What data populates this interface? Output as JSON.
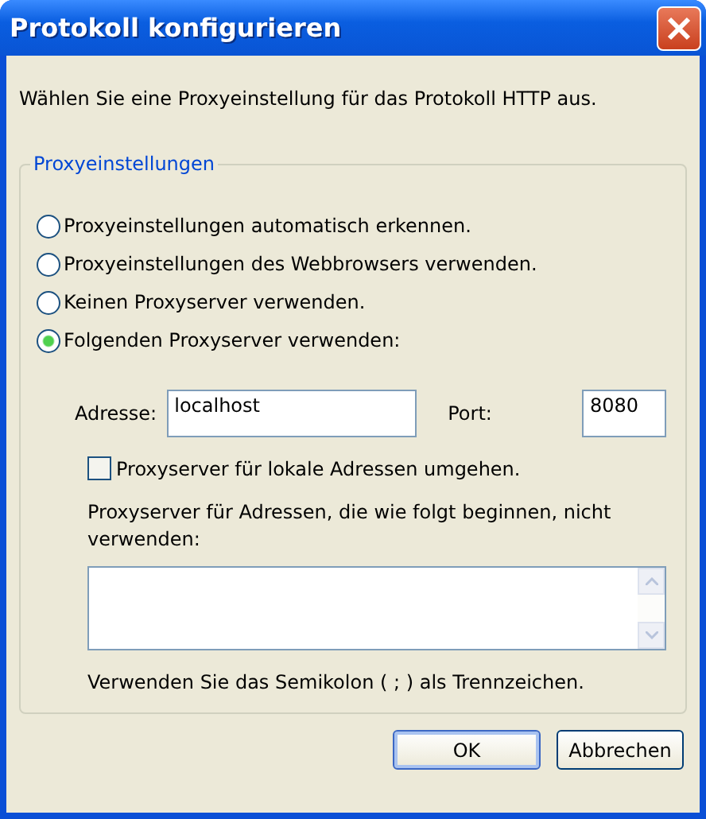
{
  "window": {
    "title": "Protokoll konfigurieren"
  },
  "intro": "Wählen Sie eine Proxyeinstellung für das Protokoll HTTP aus.",
  "group": {
    "legend": "Proxyeinstellungen",
    "options": [
      {
        "label": "Proxyeinstellungen automatisch erkennen.",
        "selected": false
      },
      {
        "label": "Proxyeinstellungen des Webbrowsers verwenden.",
        "selected": false
      },
      {
        "label": "Keinen Proxyserver verwenden.",
        "selected": false
      },
      {
        "label": "Folgenden Proxyserver verwenden:",
        "selected": true
      }
    ],
    "address": {
      "label": "Adresse:",
      "value": "localhost"
    },
    "port": {
      "label": "Port:",
      "value": "8080"
    },
    "bypass": {
      "label": "Proxyserver für lokale Adressen umgehen.",
      "checked": false
    },
    "exceptions_label": "Proxyserver für Adressen, die wie folgt beginnen, nicht verwenden:",
    "note": "Verwenden Sie das Semikolon ( ; ) als Trennzeichen."
  },
  "buttons": [
    {
      "label": "OK",
      "default": true
    },
    {
      "label": "Abbrechen",
      "default": false
    }
  ]
}
